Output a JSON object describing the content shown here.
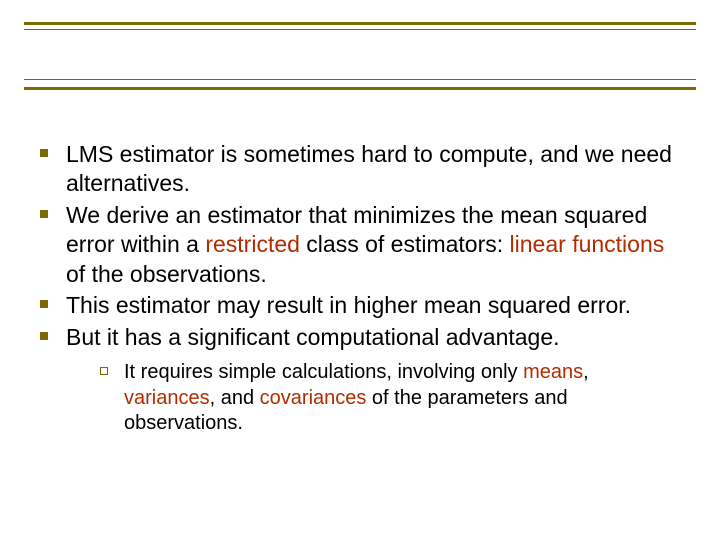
{
  "bullets": [
    {
      "pre": "LMS estimator is sometimes hard to compute, and we need alternatives.",
      "hl1": "",
      "mid": "",
      "hl2": "",
      "post": ""
    },
    {
      "pre": "We derive an estimator that minimizes the mean squared error within a ",
      "hl1": "restricted",
      "mid": " class of estimators: ",
      "hl2": "linear functions",
      "post": " of the observations."
    },
    {
      "pre": "This estimator may result in higher mean squared error.",
      "hl1": "",
      "mid": "",
      "hl2": "",
      "post": ""
    },
    {
      "pre": "But it has a significant computational advantage.",
      "hl1": "",
      "mid": "",
      "hl2": "",
      "post": ""
    }
  ],
  "sub": {
    "pre": "It requires simple calculations, involving only ",
    "hl1": "means",
    "mid1": ", ",
    "hl2": "variances",
    "mid2": ", and ",
    "hl3": "covariances",
    "post": " of the parameters and observations."
  }
}
